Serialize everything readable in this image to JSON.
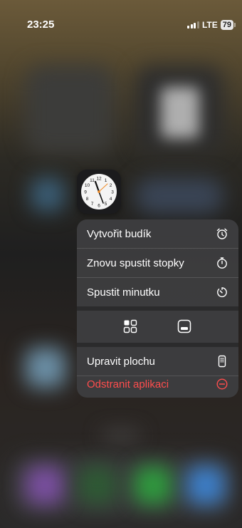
{
  "status_bar": {
    "time": "23:25",
    "network": "LTE",
    "battery": "79"
  },
  "clock_icon": {
    "numerals": [
      "12",
      "1",
      "2",
      "3",
      "4",
      "5",
      "6",
      "7",
      "8",
      "9",
      "10",
      "11"
    ]
  },
  "context_menu": {
    "items": [
      {
        "label": "Vytvořit budík",
        "icon": "alarm-clock-icon"
      },
      {
        "label": "Znovu spustit stopky",
        "icon": "stopwatch-icon"
      },
      {
        "label": "Spustit minutku",
        "icon": "timer-icon"
      }
    ],
    "widget_icons": [
      "widget-grid-icon",
      "widget-small-icon"
    ],
    "edit_home": {
      "label": "Upravit plochu",
      "icon": "phone-screen-icon"
    },
    "remove_app": {
      "label": "Odstranit aplikaci",
      "icon": "minus-circle-icon",
      "color": "#ff4d4d"
    }
  }
}
